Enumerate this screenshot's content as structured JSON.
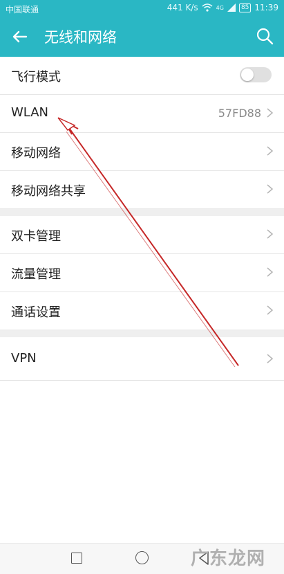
{
  "status_bar": {
    "carrier": "中国联通",
    "speed": "441 K/s",
    "signal_badge": "4G",
    "battery": "85",
    "time": "11:39"
  },
  "header": {
    "title": "无线和网络",
    "back_icon": "back-arrow-icon",
    "search_icon": "search-icon"
  },
  "settings": {
    "airplane": {
      "label": "飞行模式",
      "enabled": false
    },
    "wlan": {
      "label": "WLAN",
      "value": "57FD88"
    },
    "mobile_network": {
      "label": "移动网络"
    },
    "tethering": {
      "label": "移动网络共享"
    },
    "dual_sim": {
      "label": "双卡管理"
    },
    "data_usage": {
      "label": "流量管理"
    },
    "call_settings": {
      "label": "通话设置"
    },
    "vpn": {
      "label": "VPN"
    }
  },
  "nav_bar": {
    "recents_icon": "square-icon",
    "home_icon": "circle-icon",
    "back_icon": "triangle-back-icon"
  },
  "watermark": "广东龙网",
  "colors": {
    "accent": "#2ab7c4",
    "annotation_arrow": "#c62828"
  }
}
